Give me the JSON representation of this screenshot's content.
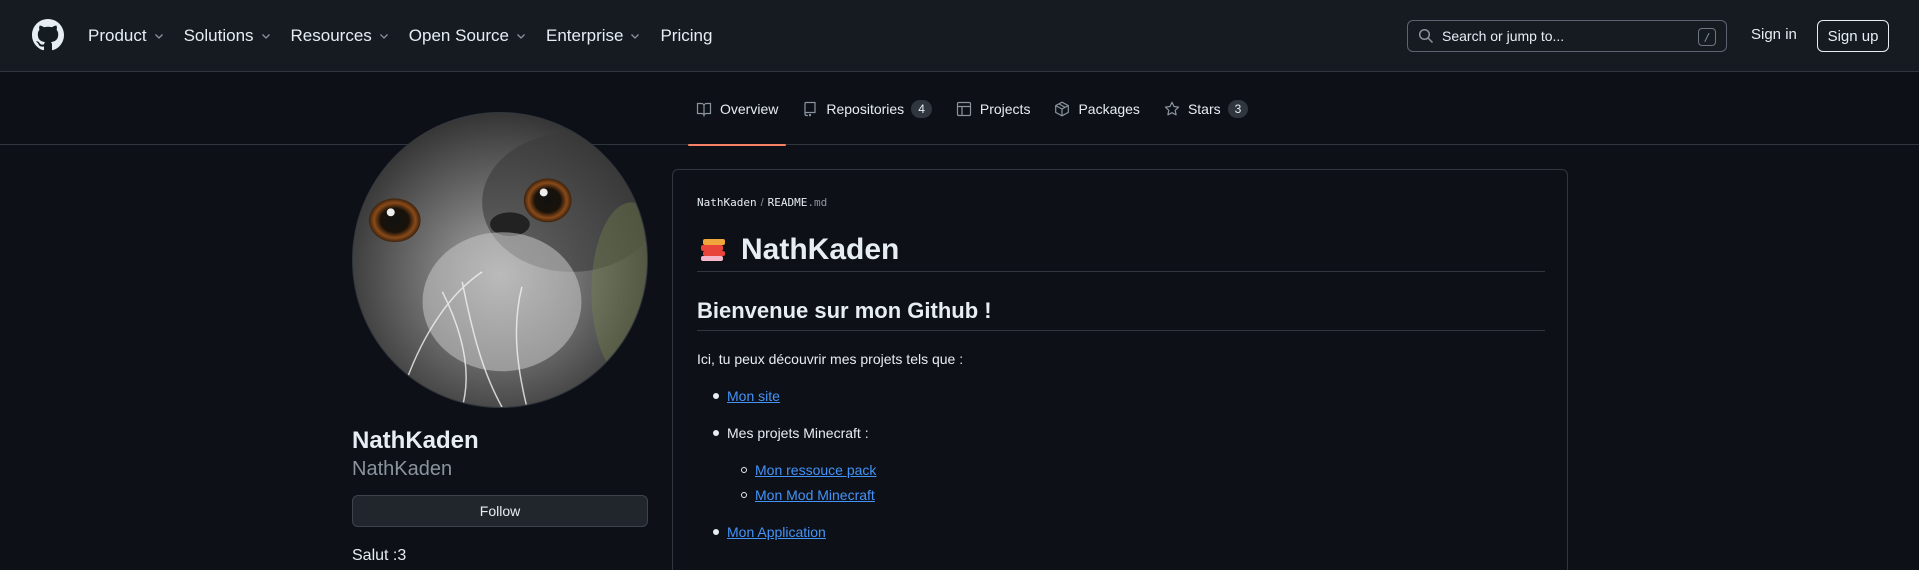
{
  "header": {
    "nav": [
      {
        "label": "Product",
        "has_menu": true
      },
      {
        "label": "Solutions",
        "has_menu": true
      },
      {
        "label": "Resources",
        "has_menu": true
      },
      {
        "label": "Open Source",
        "has_menu": true
      },
      {
        "label": "Enterprise",
        "has_menu": true
      },
      {
        "label": "Pricing",
        "has_menu": false
      }
    ],
    "search_placeholder": "Search or jump to...",
    "search_shortcut": "/",
    "sign_in": "Sign in",
    "sign_up": "Sign up"
  },
  "tabs": [
    {
      "label": "Overview",
      "icon": "book-icon",
      "active": true
    },
    {
      "label": "Repositories",
      "icon": "repo-icon",
      "count": "4"
    },
    {
      "label": "Projects",
      "icon": "table-icon"
    },
    {
      "label": "Packages",
      "icon": "package-icon"
    },
    {
      "label": "Stars",
      "icon": "star-icon",
      "count": "3"
    }
  ],
  "profile": {
    "name": "NathKaden",
    "username": "NathKaden",
    "follow": "Follow",
    "bio": "Salut :3"
  },
  "readme": {
    "owner": "NathKaden",
    "file_base": "README",
    "file_ext": ".md",
    "title": "NathKaden",
    "heading": "Bienvenue sur mon Github !",
    "intro": "Ici, tu peux découvrir mes projets tels que :",
    "items": {
      "site": "Mon site",
      "minecraft": "Mes projets Minecraft :",
      "resource_pack": "Mon ressouce pack",
      "mod": "Mon Mod Minecraft",
      "app": "Mon Application"
    }
  },
  "colors": {
    "background": "#0d1117",
    "header": "#161b22",
    "link": "#4493f8",
    "active_tab": "#f78166"
  }
}
